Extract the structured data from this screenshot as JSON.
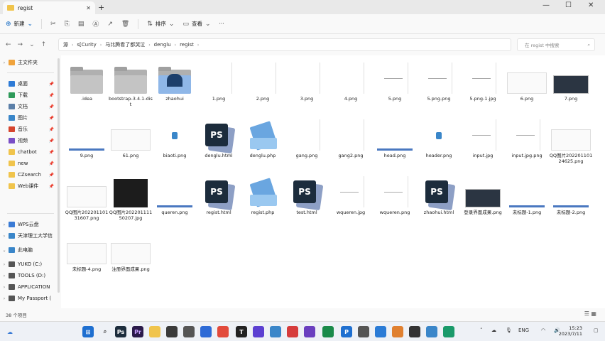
{
  "tab": {
    "title": "regist"
  },
  "window_controls": [
    "—",
    "☐",
    "✕"
  ],
  "commands": {
    "new": "新建",
    "sort": "排序",
    "view": "查看",
    "more": "···"
  },
  "breadcrumb": [
    "源",
    "s[Curity",
    "马比腾看了都哭泣",
    "denglu",
    "regist"
  ],
  "search_placeholder": "在 regist 中搜索",
  "sidebar": {
    "home": "主文件夹",
    "quick": [
      {
        "label": "桌面",
        "color": "#2e7bd6"
      },
      {
        "label": "下载",
        "color": "#2e9a5a"
      },
      {
        "label": "文档",
        "color": "#5b7fa8"
      },
      {
        "label": "图片",
        "color": "#3a86c9"
      },
      {
        "label": "音乐",
        "color": "#d6452e"
      },
      {
        "label": "视频",
        "color": "#7a4fc6"
      },
      {
        "label": "chatbot",
        "color": "#f0c44c"
      },
      {
        "label": "new",
        "color": "#f0c44c"
      },
      {
        "label": "CZsearch",
        "color": "#f0c44c"
      },
      {
        "label": "Web课件",
        "color": "#f0c44c"
      }
    ],
    "cloud": [
      {
        "label": "WPS云盘",
        "color": "#3a7bd5"
      },
      {
        "label": "天津理工大学信",
        "color": "#3a86c9"
      }
    ],
    "pc": "此电脑",
    "drives": [
      {
        "label": "YUKO (C:)",
        "color": "#555"
      },
      {
        "label": "TOOLS (D:)",
        "color": "#555"
      },
      {
        "label": "APPLICATION",
        "color": "#555"
      },
      {
        "label": "My Passport (",
        "color": "#555"
      }
    ]
  },
  "files": [
    {
      "name": ".idea",
      "kind": "folder"
    },
    {
      "name": "bootstrap-3.4.1-dist",
      "kind": "folder"
    },
    {
      "name": "zhaohui",
      "kind": "folder-blue"
    },
    {
      "name": "1.png",
      "kind": "doc"
    },
    {
      "name": "2.png",
      "kind": "doc"
    },
    {
      "name": "3.png",
      "kind": "doc"
    },
    {
      "name": "4.png",
      "kind": "doc"
    },
    {
      "name": "5.png",
      "kind": "docline"
    },
    {
      "name": "5.png.png",
      "kind": "docline"
    },
    {
      "name": "5.png-1.jpg",
      "kind": "docline"
    },
    {
      "name": "6.png",
      "kind": "shot"
    },
    {
      "name": "7.png",
      "kind": "dark2"
    },
    {
      "name": "9.png",
      "kind": "bar"
    },
    {
      "name": "61.png",
      "kind": "shot"
    },
    {
      "name": "biaoti.png",
      "kind": "icon"
    },
    {
      "name": "denglu.html",
      "kind": "ps"
    },
    {
      "name": "denglu.php",
      "kind": "php"
    },
    {
      "name": "gang.png",
      "kind": "doc"
    },
    {
      "name": "gang2.png",
      "kind": "doc"
    },
    {
      "name": "head.png",
      "kind": "bar"
    },
    {
      "name": "header.png",
      "kind": "icon"
    },
    {
      "name": "input.jpg",
      "kind": "docline"
    },
    {
      "name": "input.jpg.png",
      "kind": "docline"
    },
    {
      "name": "QQ图片20220110124625.png",
      "kind": "shot"
    },
    {
      "name": "QQ图片20220110131607.png",
      "kind": "shot"
    },
    {
      "name": "QQ图片20220111150207.jpg",
      "kind": "dark"
    },
    {
      "name": "queren.png",
      "kind": "bar"
    },
    {
      "name": "regist.html",
      "kind": "ps"
    },
    {
      "name": "regist.php",
      "kind": "php"
    },
    {
      "name": "test.html",
      "kind": "ps"
    },
    {
      "name": "wqueren.jpg",
      "kind": "docline"
    },
    {
      "name": "wqueren.png",
      "kind": "docline"
    },
    {
      "name": "zhaohui.html",
      "kind": "ps"
    },
    {
      "name": "登录界面成果.png",
      "kind": "dark2"
    },
    {
      "name": "未标题-1.png",
      "kind": "bar"
    },
    {
      "name": "未标题-2.png",
      "kind": "bar"
    },
    {
      "name": "未标题-4.png",
      "kind": "shot"
    },
    {
      "name": "注册界面成果.png",
      "kind": "shot"
    }
  ],
  "status": {
    "count": "38 个项目"
  },
  "taskbar": {
    "lang": "ENG",
    "time": "15:23",
    "date": "2023/7/11"
  }
}
